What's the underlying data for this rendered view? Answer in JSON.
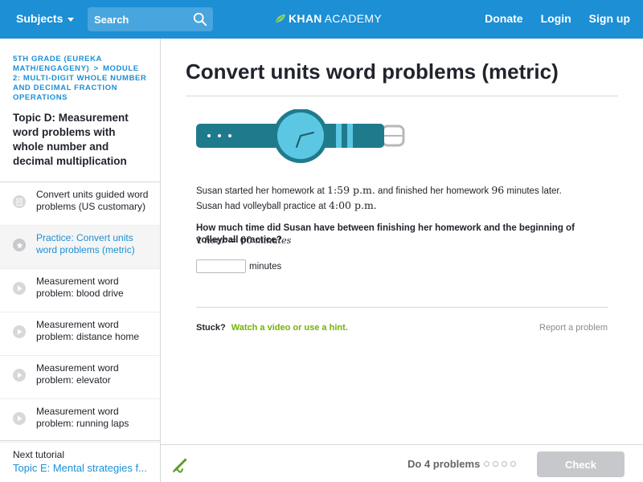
{
  "nav": {
    "subjects_label": "Subjects",
    "search_placeholder": "Search",
    "logo_khan": "KHAN",
    "logo_academy": "ACADEMY",
    "donate": "Donate",
    "login": "Login",
    "signup": "Sign up"
  },
  "sidebar": {
    "breadcrumb_1": "5th grade (Eureka Math/EngageNY)",
    "breadcrumb_sep": ">",
    "breadcrumb_2": "Module 2: Multi-digit whole number and decimal fraction operations",
    "topic_title": "Topic D: Measurement word problems with whole number and decimal multiplication",
    "items": [
      {
        "label": "Convert units guided word problems (US customary)",
        "type": "article"
      },
      {
        "label": "Practice: Convert units word problems (metric)",
        "type": "exercise"
      },
      {
        "label": "Measurement word problem: blood drive",
        "type": "video"
      },
      {
        "label": "Measurement word problem: distance home",
        "type": "video"
      },
      {
        "label": "Measurement word problem: elevator",
        "type": "video"
      },
      {
        "label": "Measurement word problem: running laps",
        "type": "video"
      }
    ],
    "next_label": "Next tutorial",
    "next_title": "Topic E: Mental strategies f..."
  },
  "main": {
    "title": "Convert units word problems (metric)",
    "problem_p1": "Susan started her homework at ",
    "time1": "1:59 p.m.",
    "problem_p2": " and finished her homework ",
    "minutes_value": "96",
    "problem_p3": " minutes later. Susan had volleyball practice at ",
    "time2": "4:00 p.m.",
    "question": "How much time did Susan have between finishing her homework and the beginning of volleyball practice?",
    "given_1": "1",
    "given_hour": "hour",
    "given_eq": " = 60 ",
    "given_minutes": "minutes",
    "answer_unit": "minutes",
    "answer_value": "",
    "stuck": "Stuck?",
    "hint_link": "Watch a video or use a hint.",
    "report": "Report a problem"
  },
  "footer": {
    "do_problems": "Do 4 problems",
    "progress_completed": 0,
    "progress_total": 4,
    "check_label": "Check"
  },
  "colors": {
    "brand_blue": "#1c8fd5",
    "hint_green": "#71b307",
    "watch_band": "#1f7b8c",
    "watch_face": "#5bc7e3"
  },
  "icons": [
    "search-icon",
    "khan-leaf-icon",
    "article-icon",
    "exercise-star-icon",
    "video-play-icon",
    "scratchpad-pencil-icon",
    "watch-illustration"
  ]
}
